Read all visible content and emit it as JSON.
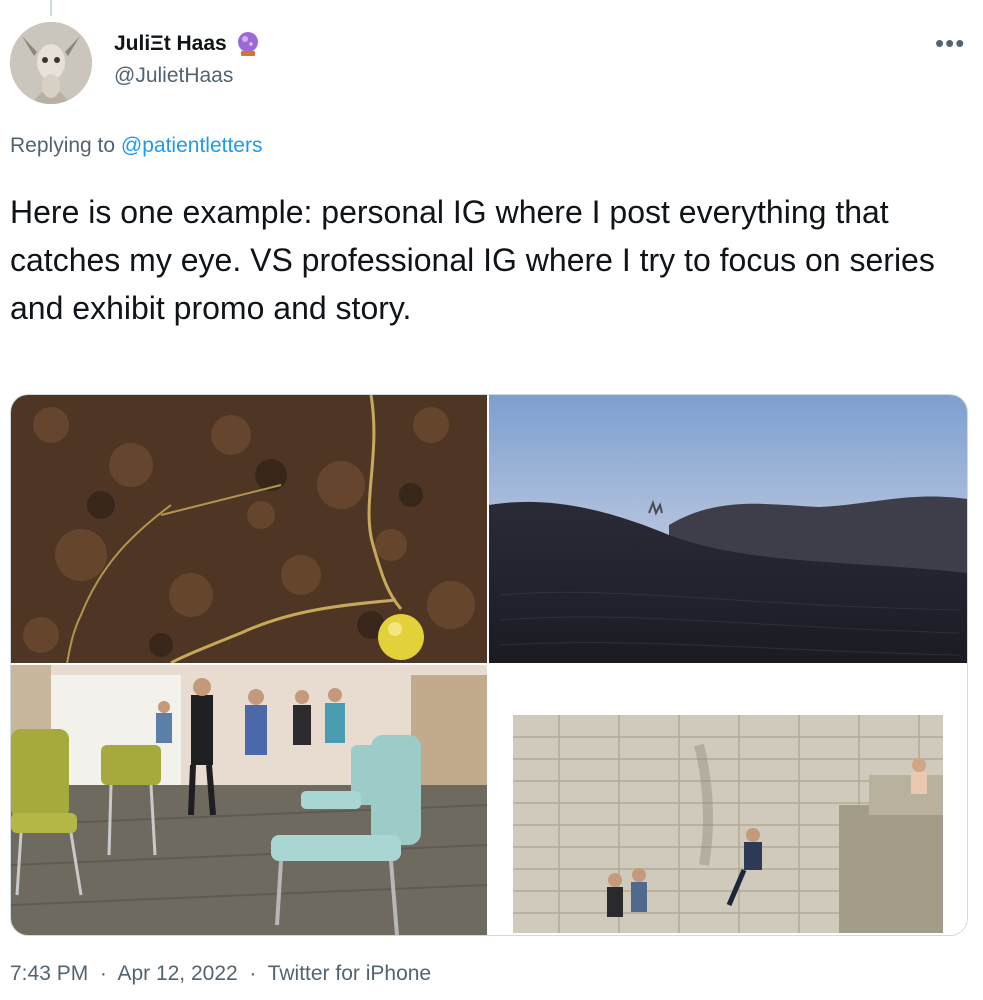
{
  "author": {
    "display_name": "JuliΞt Haas",
    "handle": "@JulietHaas",
    "badge_icon": "crystal-ball-icon"
  },
  "reply": {
    "prefix": "Replying to",
    "target": "@patientletters"
  },
  "tweet": {
    "text": "Here is one example: personal IG where I post everything that catches my eye. VS professional IG where I try to focus on series and exhibit promo and story."
  },
  "meta": {
    "time": "7:43 PM",
    "separator": "·",
    "date": "Apr 12, 2022",
    "source": "Twitter for iPhone"
  },
  "icons": {
    "more": "more-horizontal-icon"
  },
  "colors": {
    "link": "#1d9bf0",
    "secondary_text": "#536471",
    "primary_text": "#0f1419"
  }
}
